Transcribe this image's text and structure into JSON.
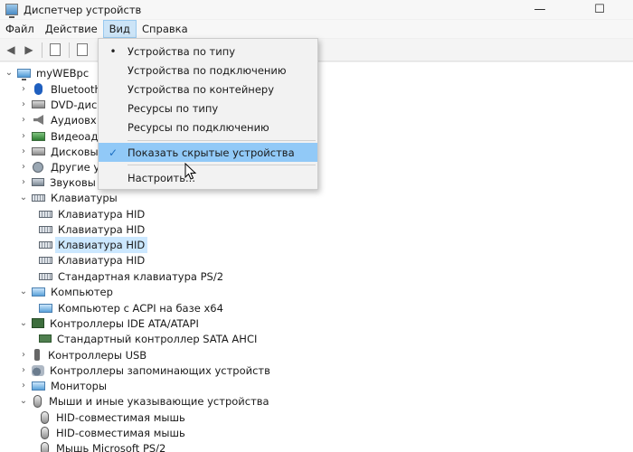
{
  "window": {
    "title": "Диспетчер устройств",
    "controls": {
      "minimize": "—",
      "maximize": "☐"
    }
  },
  "menu": [
    "Файл",
    "Действие",
    "Вид",
    "Справка"
  ],
  "toolbar": {
    "back": "◀",
    "forward": "▶"
  },
  "view_menu": {
    "items": [
      {
        "label": "Устройства по типу",
        "mark": "•"
      },
      {
        "label": "Устройства по подключению",
        "mark": ""
      },
      {
        "label": "Устройства по контейнеру",
        "mark": ""
      },
      {
        "label": "Ресурсы по типу",
        "mark": ""
      },
      {
        "label": "Ресурсы по подключению",
        "mark": ""
      },
      {
        "label": "Показать скрытые устройства",
        "mark": "✓"
      },
      {
        "label": "Настроить...",
        "mark": ""
      }
    ]
  },
  "tree": {
    "root": "myWEBpc",
    "arrow_collapsed": "›",
    "arrow_expanded": "⌄",
    "categories_top": [
      "Bluetooth",
      "DVD-диск",
      "Аудиовх",
      "Видеоад",
      "Дисковы",
      "Другие у",
      "Звуковы"
    ],
    "keyboards": {
      "label": "Клавиатуры",
      "children": [
        "Клавиатура HID",
        "Клавиатура HID",
        "Клавиатура HID",
        "Клавиатура HID",
        "Стандартная клавиатура PS/2"
      ]
    },
    "computer": {
      "label": "Компьютер",
      "children": [
        "Компьютер с ACPI на базе x64"
      ]
    },
    "ide": {
      "label": "Контроллеры IDE ATA/ATAPI",
      "children": [
        "Стандартный контроллер SATA AHCI"
      ]
    },
    "usb": "Контроллеры USB",
    "storage": "Контроллеры запоминающих устройств",
    "monitors": "Мониторы",
    "mice": {
      "label": "Мыши и иные указывающие устройства",
      "children": [
        "HID-совместимая мышь",
        "HID-совместимая мышь",
        "Мышь Microsoft PS/2"
      ]
    }
  }
}
